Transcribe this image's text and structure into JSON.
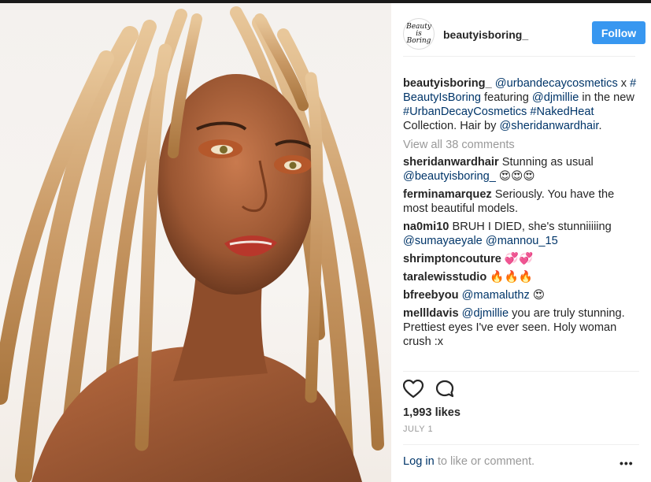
{
  "post": {
    "author": "beautyisboring_",
    "avatar_text": "Beauty is Boring",
    "follow_label": "Follow",
    "caption": {
      "mention1": "@urbandecaycosmetics",
      "sep1": " x ",
      "tag1": "#BeautyIsBoring",
      "text1": " featuring ",
      "mention2": "@djmillie",
      "text2": " in the new ",
      "tag2": "#UrbanDecayCosmetics",
      "sep2": " ",
      "tag3": "#NakedHeat",
      "text3": " Collection. Hair by ",
      "mention3": "@sheridanwardhair",
      "text4": "."
    },
    "view_all": "View all 38 comments",
    "comments": [
      {
        "user": "sheridanwardhair",
        "text": "Stunning as usual ",
        "mention": "@beautyisboring_",
        "emoji": " 😍😍😍"
      },
      {
        "user": "ferminamarquez",
        "text": "Seriously. You have the most beautiful models."
      },
      {
        "user": "na0mi10",
        "text": "BRUH I DIED, she's stunniiiiing ",
        "mention": "@sumayaeyale",
        "text2": " ",
        "mention2": "@mannou_15"
      },
      {
        "user": "shrimptoncouture",
        "emoji": "💞💞"
      },
      {
        "user": "taralewisstudio",
        "emoji": "🔥🔥🔥"
      },
      {
        "user": "bfreebyou",
        "mention": "@mamaluthz",
        "emoji": " 😍"
      },
      {
        "user": "mellldavis",
        "mention": "@djmillie",
        "text": " you are truly stunning. Prettiest eyes I've ever seen. Holy woman crush :x"
      }
    ],
    "likes": "1,993 likes",
    "date": "JULY 1",
    "login_link": "Log in",
    "login_text": " to like or comment.",
    "more": "•••",
    "icons": {
      "like": "heart-icon",
      "comment": "comment-bubble-icon",
      "more": "more-options-icon"
    },
    "colors": {
      "follow": "#3897f0",
      "link": "#003569",
      "muted": "#999999"
    }
  }
}
